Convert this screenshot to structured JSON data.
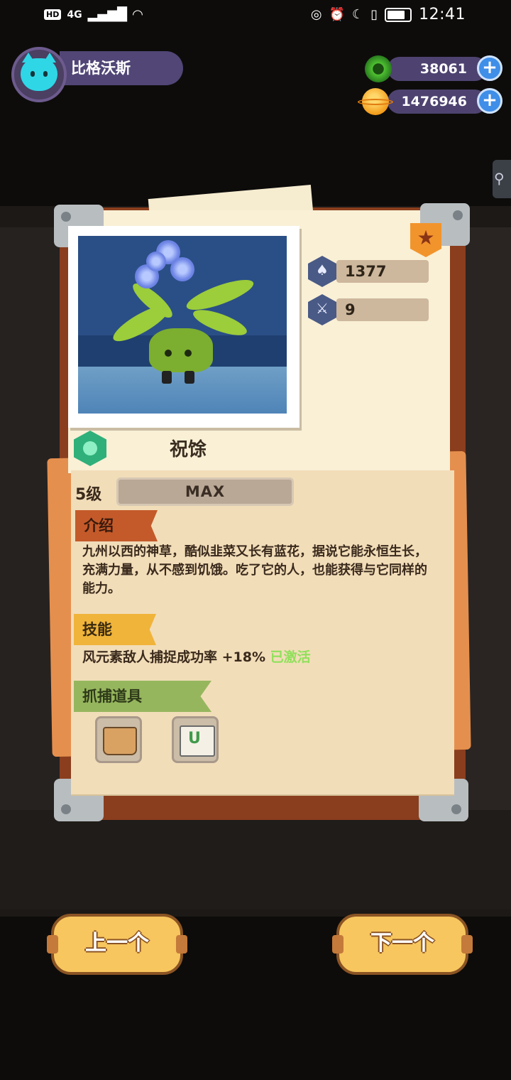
{
  "status_bar": {
    "network": "4G",
    "hd": "HD",
    "time": "12:41"
  },
  "player": {
    "name": "比格沃斯"
  },
  "currency": {
    "gems": "38061",
    "coins": "1476946",
    "add_symbol": "+"
  },
  "creature": {
    "name": "祝馀",
    "stats": [
      {
        "icon": "power-icon",
        "value": "1377"
      },
      {
        "icon": "attack-icon",
        "value": "9"
      }
    ],
    "level_label": "5级",
    "level_bar": "MAX",
    "level_progress": 1.0
  },
  "sections": {
    "intro_label": "介绍",
    "intro_text": "九州以西的神草，酷似韭菜又长有蓝花，据说它能永恒生长，充满力量，从不感到饥饿。吃了它的人，也能获得与它同样的能力。",
    "skill_label": "技能",
    "skill_text": "风元素敌人捕捉成功率 +18%",
    "skill_status": "已激活",
    "tools_label": "抓捕道具"
  },
  "nav": {
    "prev": "上一个",
    "next": "下一个"
  },
  "colors": {
    "accent_purple": "#514676",
    "button_yellow": "#f7c65e",
    "skill_active_green": "#8fe05a"
  }
}
